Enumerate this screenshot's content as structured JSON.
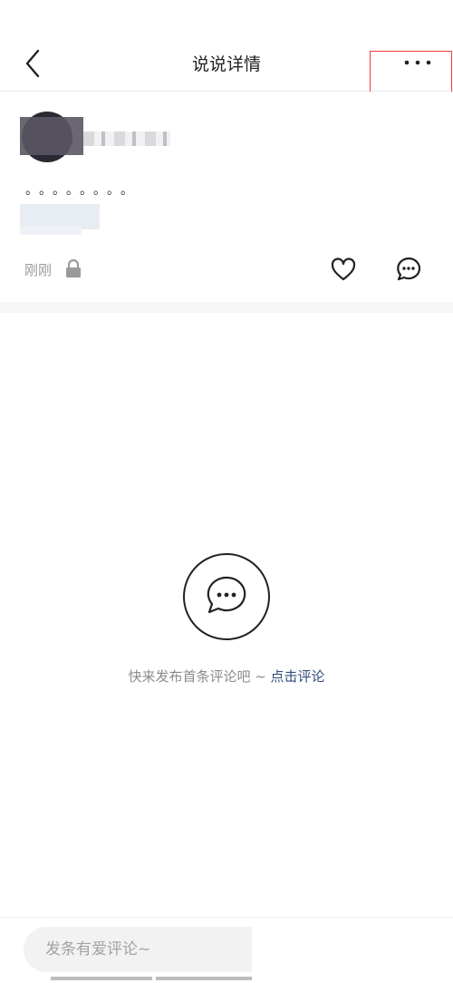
{
  "header": {
    "title": "说说详情",
    "back_icon": "chevron-left-icon",
    "more_icon": "more-dots-icon"
  },
  "annotation": {
    "box_color": "#f03b3b",
    "arrow_color": "#f03b3b"
  },
  "post": {
    "content": "。。。。。。。。",
    "time": "刚刚",
    "privacy_icon": "lock-icon",
    "like_icon": "heart-icon",
    "comment_icon": "comment-bubble-icon"
  },
  "empty_state": {
    "icon": "comment-bubble-icon",
    "text": "快来发布首条评论吧 ~ ",
    "link": "点击评论",
    "link_color": "#2f4d7c"
  },
  "bottom_bar": {
    "placeholder": "发条有爱评论~"
  }
}
